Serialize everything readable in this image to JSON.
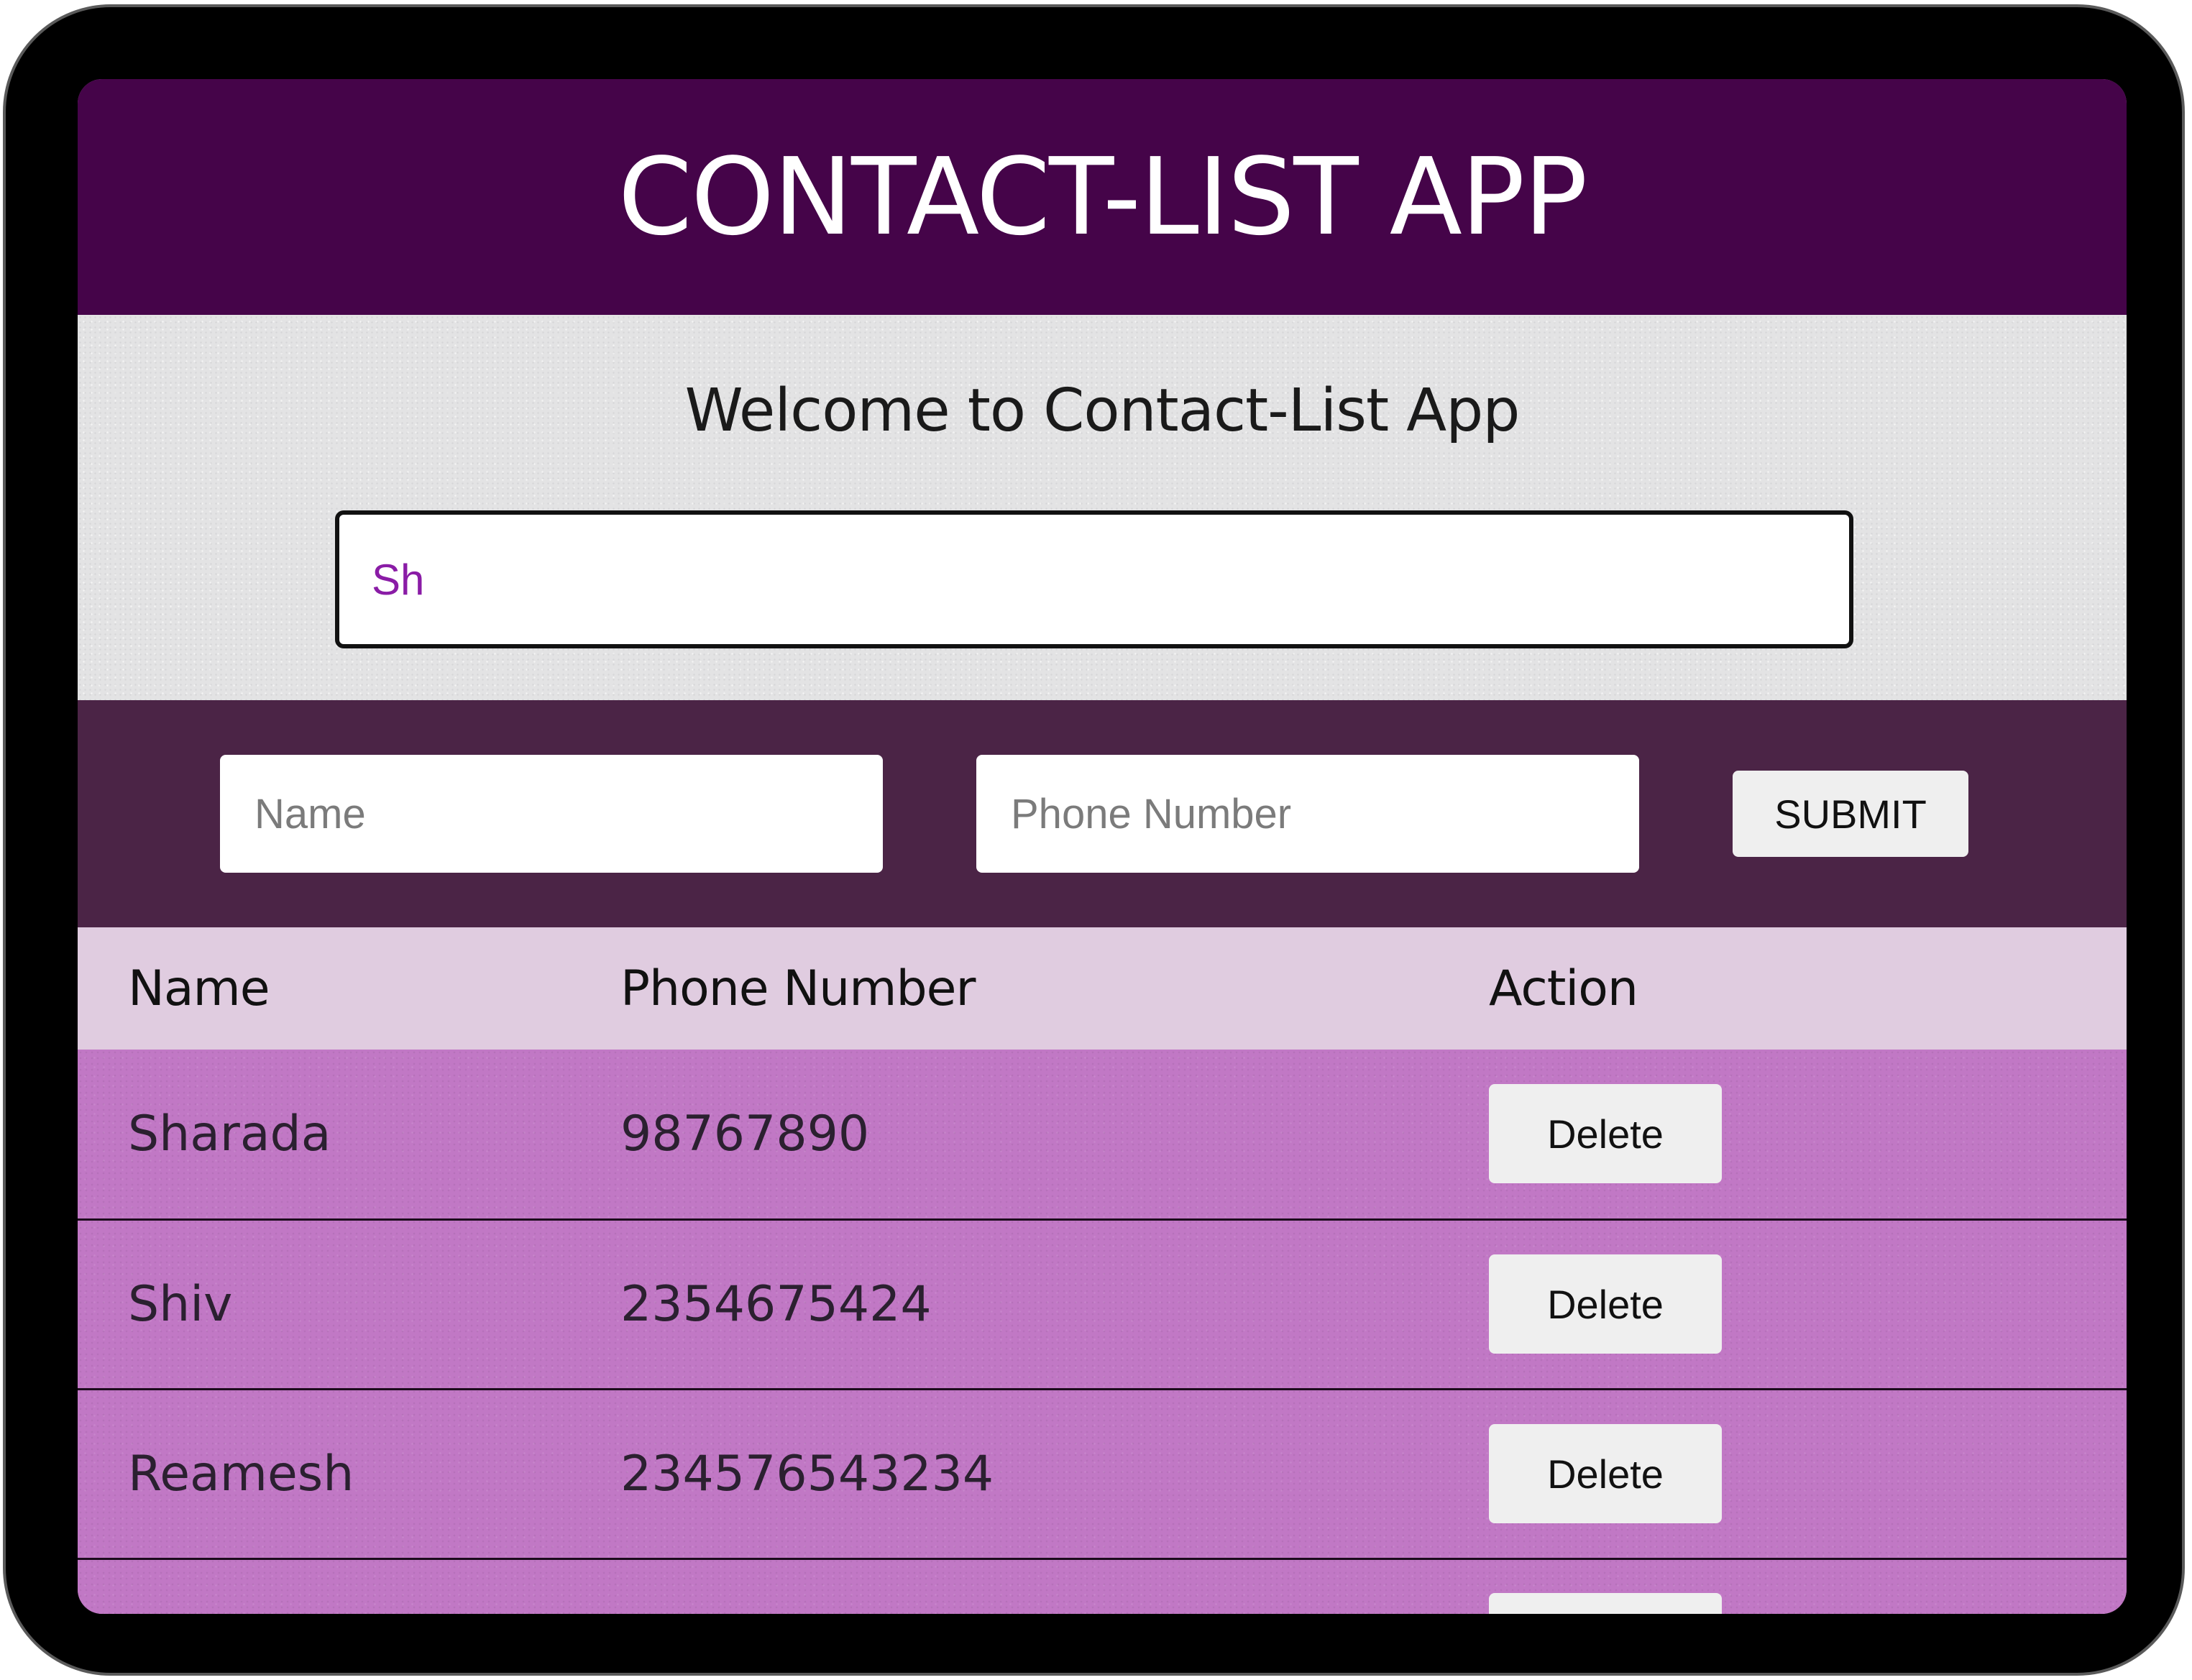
{
  "app": {
    "title": "CONTACT-LIST APP"
  },
  "search": {
    "welcome_text": "Welcome to Contact-List App",
    "value": "Sh"
  },
  "form": {
    "name_placeholder": "Name",
    "phone_placeholder": "Phone Number",
    "submit_label": "SUBMIT"
  },
  "table": {
    "headers": {
      "name": "Name",
      "phone": "Phone Number",
      "action": "Action"
    },
    "rows": [
      {
        "name": "Sharada",
        "phone": "98767890",
        "action_label": "Delete"
      },
      {
        "name": "Shiv",
        "phone": "2354675424",
        "action_label": "Delete"
      },
      {
        "name": "Reamesh",
        "phone": "234576543234",
        "action_label": "Delete"
      }
    ]
  },
  "colors": {
    "header_bg": "#450449",
    "form_bg": "#4b2446",
    "table_header_bg": "#e0cce0",
    "row_bg": "#c178c5",
    "search_text": "#8a1ca6"
  }
}
